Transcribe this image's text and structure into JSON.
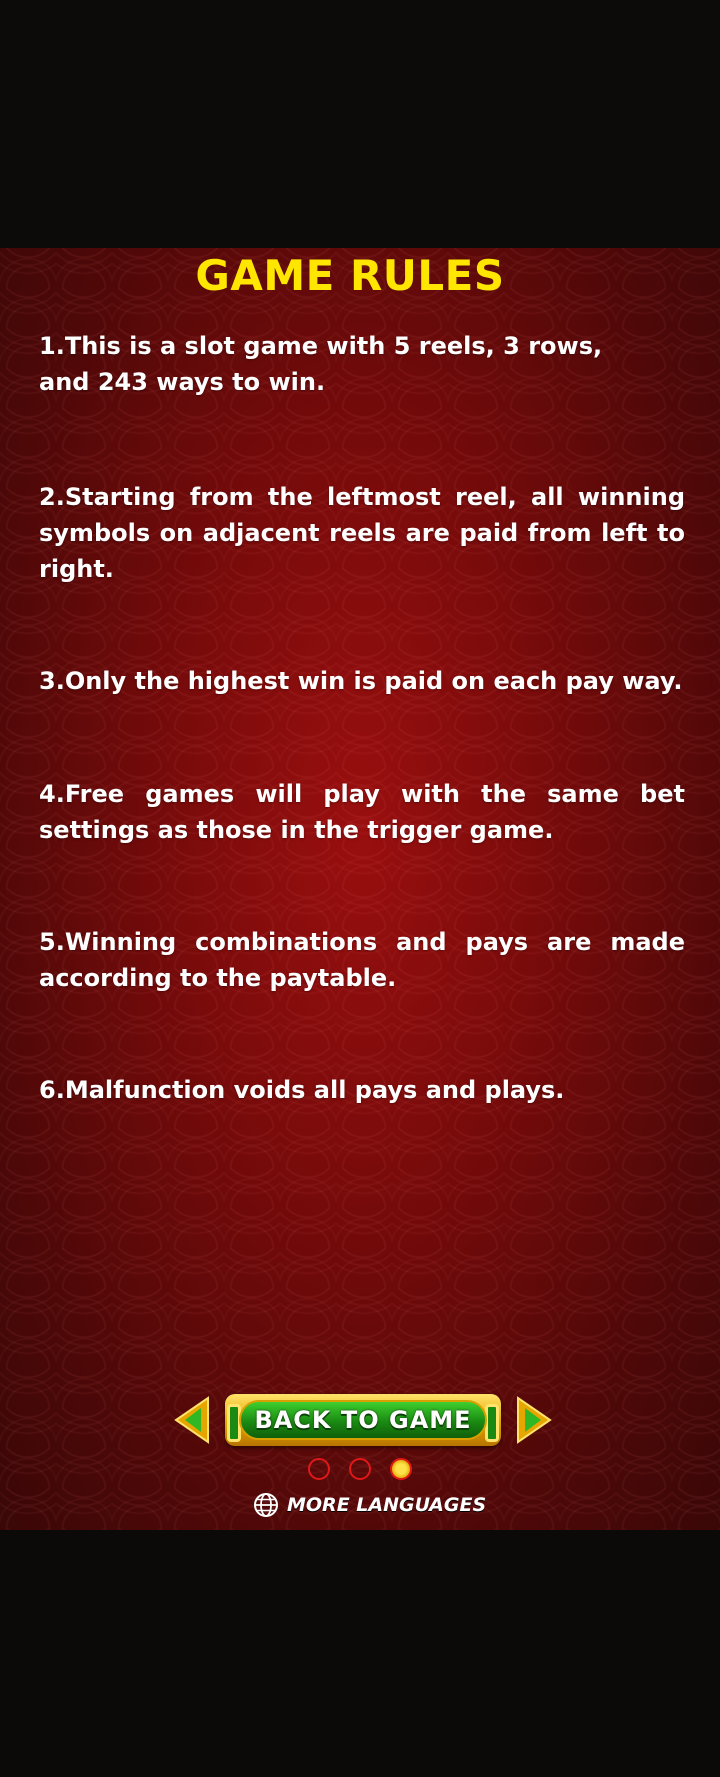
{
  "title": "GAME RULES",
  "rules": [
    "1.This is a slot game with 5 reels, 3 rows, and 243 ways to win.",
    "2.Starting from the leftmost reel, all winning symbols on adjacent reels are paid from left to right.",
    "3.Only the highest win is paid on each pay way.",
    "4.Free games will play with the same bet settings as those in the trigger game.",
    "5.Winning combinations and pays are made according to the paytable.",
    "6.Malfunction voids all pays and plays."
  ],
  "back_button_label": "BACK TO GAME",
  "pagination": {
    "total": 3,
    "active_index": 2
  },
  "more_languages_label": "MORE LANGUAGES",
  "colors": {
    "title": "#ffe600",
    "background_red": "#8b0d0d",
    "button_green": "#1a8a12",
    "button_gold": "#e7a500",
    "dot_ring": "#e01818",
    "dot_active": "#ffe14a"
  },
  "icons": [
    "arrow-left-icon",
    "arrow-right-icon",
    "globe-icon"
  ]
}
